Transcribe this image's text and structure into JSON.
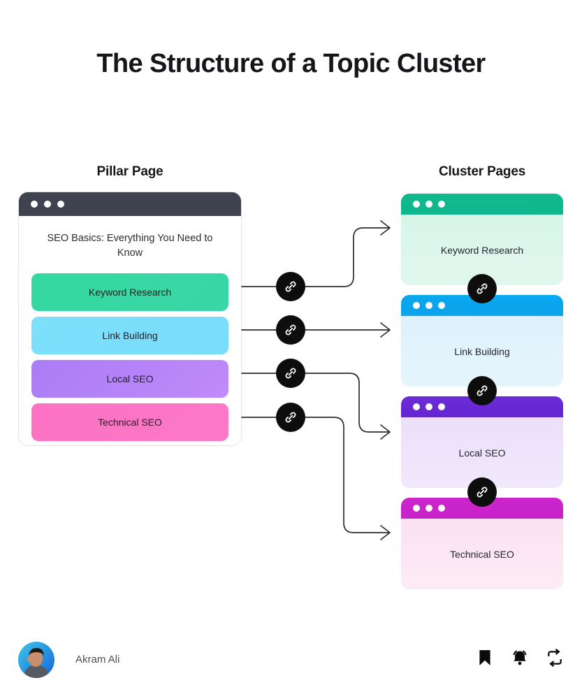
{
  "title": "The Structure of a Topic Cluster",
  "columns": {
    "pillar_heading": "Pillar Page",
    "cluster_heading": "Cluster Pages"
  },
  "pillar": {
    "page_title": "SEO Basics: Everything You Need to Know",
    "topics": [
      {
        "label": "Keyword Research",
        "color": "#35d9a0"
      },
      {
        "label": "Link Building",
        "color": "#7ee0fb"
      },
      {
        "label": "Local SEO",
        "color": "#ab7cf5"
      },
      {
        "label": "Technical SEO",
        "color": "#fd72c4"
      }
    ]
  },
  "clusters": [
    {
      "label": "Keyword Research",
      "header_color": "#10b98c",
      "body_color": "#d8f5e9"
    },
    {
      "label": "Link Building",
      "header_color": "#09a8f0",
      "body_color": "#ddf1fb"
    },
    {
      "label": "Local SEO",
      "header_color": "#6c2bd9",
      "body_color": "#ece0fa"
    },
    {
      "label": "Technical SEO",
      "header_color": "#cc25cc",
      "body_color": "#fbe2f1"
    }
  ],
  "link_badges": {
    "icon": "chain-link-icon",
    "count": 7,
    "color": "#0d0d0d"
  },
  "connectors": {
    "count": 4,
    "color": "#2b2d33",
    "arrowhead": "open-chevron"
  },
  "footer": {
    "author": "Akram Ali",
    "icons": [
      "bookmark-icon",
      "bell-icon",
      "repeat-icon"
    ]
  }
}
